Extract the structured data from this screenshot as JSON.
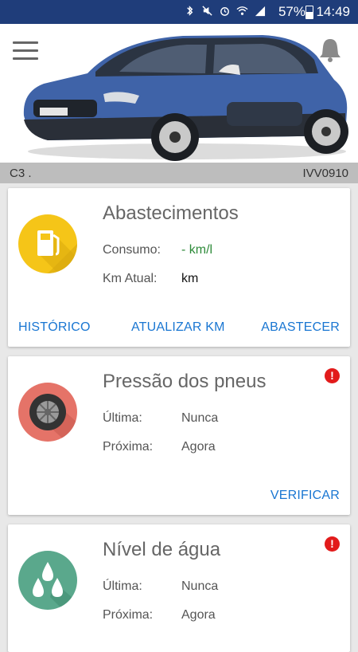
{
  "status_bar": {
    "battery_percent": "57%",
    "time": "14:49",
    "icons": [
      "bluetooth-icon",
      "mute-icon",
      "alarm-icon",
      "wifi-icon",
      "signal-icon",
      "battery-icon"
    ]
  },
  "vehicle": {
    "model": "C3 .",
    "plate": "IVV0910"
  },
  "cards": {
    "fuel": {
      "title": "Abastecimentos",
      "consumption_label": "Consumo:",
      "consumption_value": "- km/l",
      "km_label": "Km Atual:",
      "km_value": "km",
      "actions": {
        "history": "HISTÓRICO",
        "update_km": "ATUALIZAR KM",
        "refuel": "ABASTECER"
      },
      "icon": "fuel-pump-icon",
      "color": "#f5c518"
    },
    "tires": {
      "title": "Pressão dos pneus",
      "last_label": "Última:",
      "last_value": "Nunca",
      "next_label": "Próxima:",
      "next_value": "Agora",
      "action": "VERIFICAR",
      "alert": "!",
      "icon": "tire-icon",
      "color": "#e57368"
    },
    "water": {
      "title": "Nível de água",
      "last_label": "Última:",
      "last_value": "Nunca",
      "next_label": "Próxima:",
      "next_value": "Agora",
      "alert": "!",
      "icon": "water-drops-icon",
      "color": "#5aa88c"
    }
  },
  "colors": {
    "status_bar": "#1f3d7a",
    "action": "#1976d2",
    "consumption_value": "#2e8b3a",
    "alert": "#e21b1b"
  }
}
